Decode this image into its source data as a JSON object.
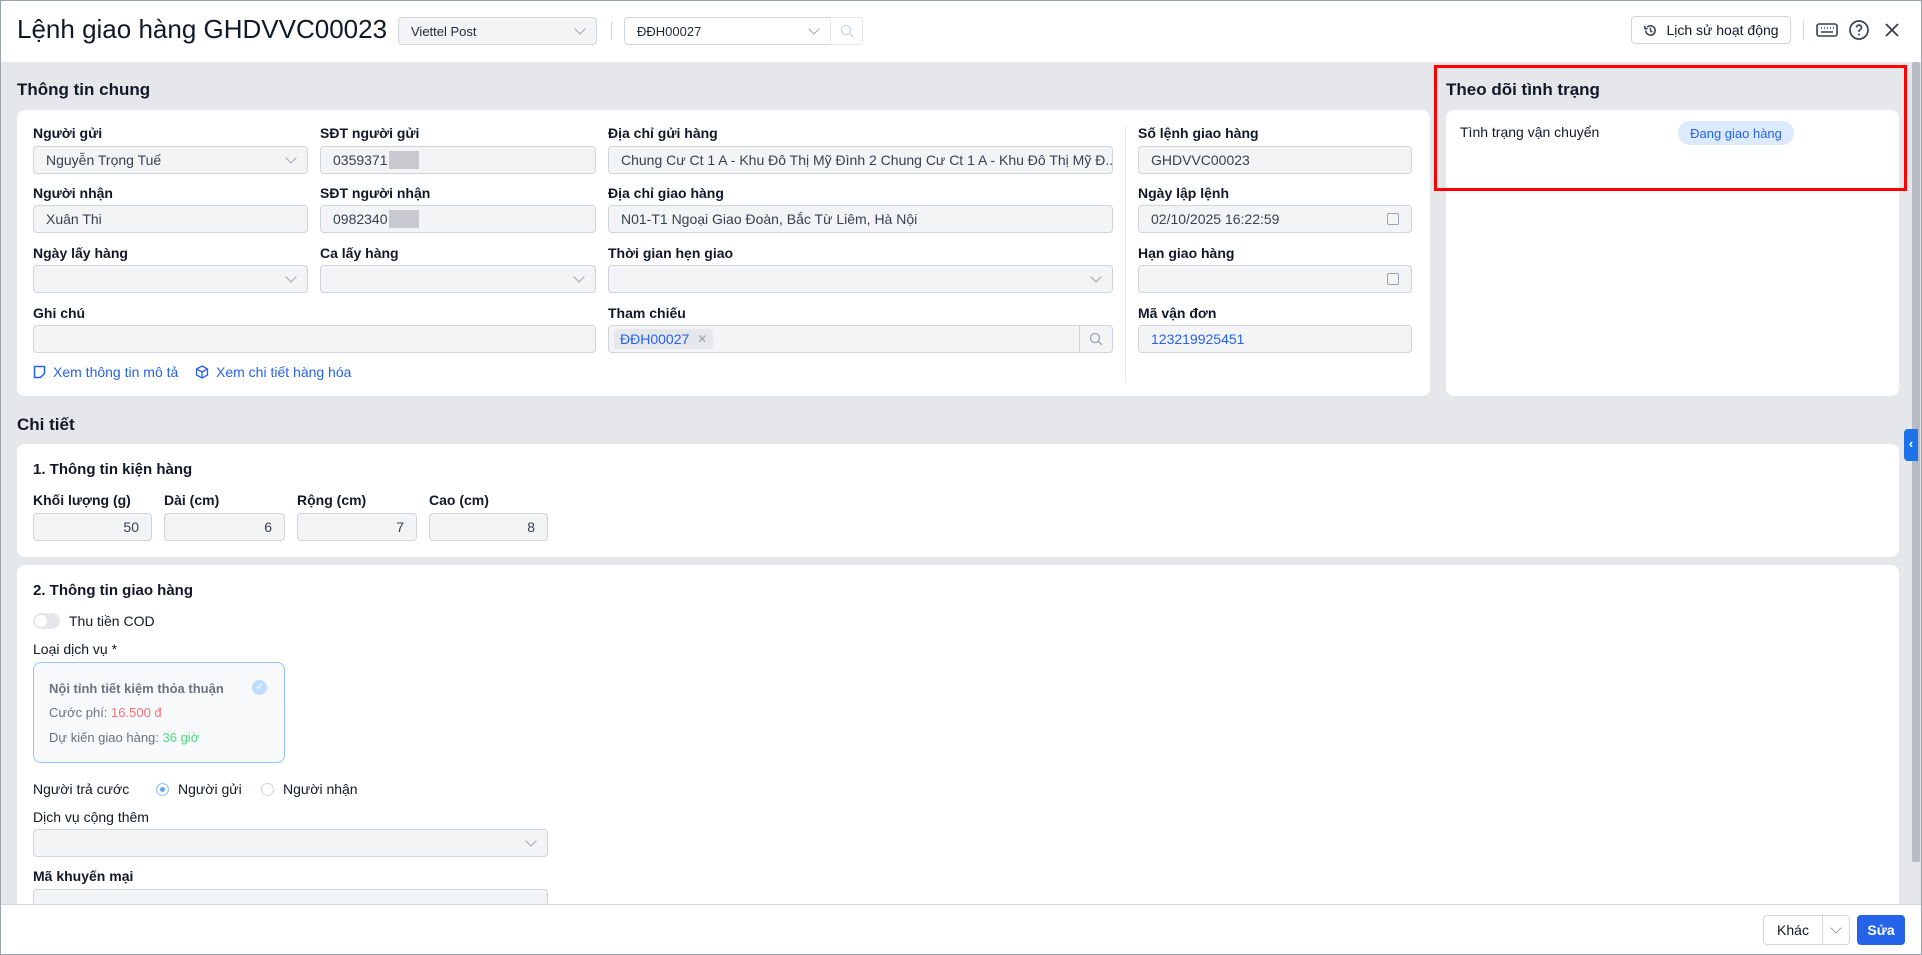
{
  "header": {
    "title": "Lệnh giao hàng GHDVVC00023",
    "carrier": "Viettel Post",
    "order": "ĐĐH00027",
    "history_label": "Lịch sử hoạt động"
  },
  "general": {
    "title": "Thông tin chung",
    "sender_label": "Người gửi",
    "sender": "Nguyễn Trọng Tuế",
    "sender_phone_label": "SĐT người gửi",
    "sender_phone": "0359371",
    "pickup_address_label": "Địa chỉ gửi hàng",
    "pickup_address": "Chung Cư Ct 1 A - Khu Đô Thị Mỹ Đình 2 Chung Cư Ct 1 A - Khu Đô Thị Mỹ Đ...",
    "receiver_label": "Người nhận",
    "receiver": "Xuân Thi",
    "receiver_phone_label": "SĐT người nhận",
    "receiver_phone": "0982340",
    "delivery_address_label": "Địa chỉ giao hàng",
    "delivery_address": "N01-T1 Ngoại Giao Đoàn, Bắc Từ Liêm, Hà Nội",
    "pickup_date_label": "Ngày lấy hàng",
    "pickup_shift_label": "Ca lấy hàng",
    "appointment_label": "Thời gian hẹn giao",
    "note_label": "Ghi chú",
    "reference_label": "Tham chiếu",
    "reference_tag": "ĐĐH00027",
    "order_no_label": "Số lệnh giao hàng",
    "order_no": "GHDVVC00023",
    "created_label": "Ngày lập lệnh",
    "created": "02/10/2025 16:22:59",
    "deadline_label": "Hạn giao hàng",
    "waybill_label": "Mã vận đơn",
    "waybill": "123219925451",
    "link_description": "Xem thông tin mô tả",
    "link_goods": "Xem chi tiết hàng hóa"
  },
  "tracking": {
    "title": "Theo dõi tình trạng",
    "status_label": "Tình trạng vận chuyển",
    "status": "Đang giao hàng"
  },
  "detail": {
    "title": "Chi tiết",
    "package": {
      "title": "1. Thông tin kiện hàng",
      "weight_label": "Khối lượng (g)",
      "weight": "50",
      "length_label": "Dài (cm)",
      "length": "6",
      "width_label": "Rộng (cm)",
      "width": "7",
      "height_label": "Cao (cm)",
      "height": "8"
    },
    "delivery": {
      "title": "2. Thông tin giao hàng",
      "cod_label": "Thu tiền COD",
      "service_label": "Loại dịch vụ *",
      "service_name": "Nội tỉnh tiết kiệm thỏa thuận",
      "fee_label": "Cước phí: ",
      "fee": "16.500 đ",
      "eta_label": "Dự kiến giao hàng: ",
      "eta": "36 giờ",
      "payer_label": "Người trả cước",
      "payer_sender": "Người gửi",
      "payer_receiver": "Người nhận",
      "addon_label": "Dịch vụ cộng thêm",
      "promo_label": "Mã khuyến mại"
    }
  },
  "footer": {
    "other_label": "Khác",
    "edit_label": "Sửa"
  }
}
